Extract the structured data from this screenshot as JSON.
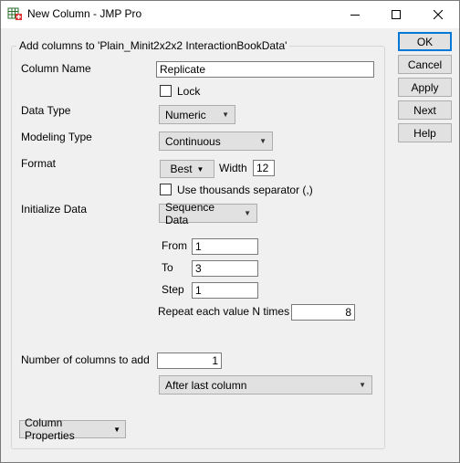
{
  "window": {
    "title": "New Column - JMP Pro",
    "icon": "jmp-table-icon",
    "minimize_icon": "minimize-icon",
    "maximize_icon": "maximize-icon",
    "close_icon": "close-icon"
  },
  "group": {
    "legend": "Add columns to 'Plain_Minit2x2x2 InteractionBookData'"
  },
  "form": {
    "column_name_label": "Column Name",
    "column_name_value": "Replicate",
    "lock_label": "Lock",
    "lock_checked": false,
    "data_type_label": "Data Type",
    "data_type_value": "Numeric",
    "modeling_type_label": "Modeling Type",
    "modeling_type_value": "Continuous",
    "format_label": "Format",
    "format_value": "Best",
    "width_label": "Width",
    "width_value": "12",
    "thousands_label": "Use thousands separator (,)",
    "thousands_checked": false,
    "init_label": "Initialize Data",
    "init_value": "Sequence Data",
    "from_label": "From",
    "from_value": "1",
    "to_label": "To",
    "to_value": "3",
    "step_label": "Step",
    "step_value": "1",
    "repeat_label": "Repeat each value N times",
    "repeat_value": "8",
    "num_cols_label": "Number of columns to add",
    "num_cols_value": "1",
    "position_value": "After last column",
    "col_props_label": "Column Properties"
  },
  "buttons": {
    "ok": "OK",
    "cancel": "Cancel",
    "apply": "Apply",
    "next": "Next",
    "help": "Help"
  },
  "colors": {
    "accent": "#0078d7",
    "window_bg": "#f0f0f0",
    "button_bg": "#e1e1e1"
  }
}
